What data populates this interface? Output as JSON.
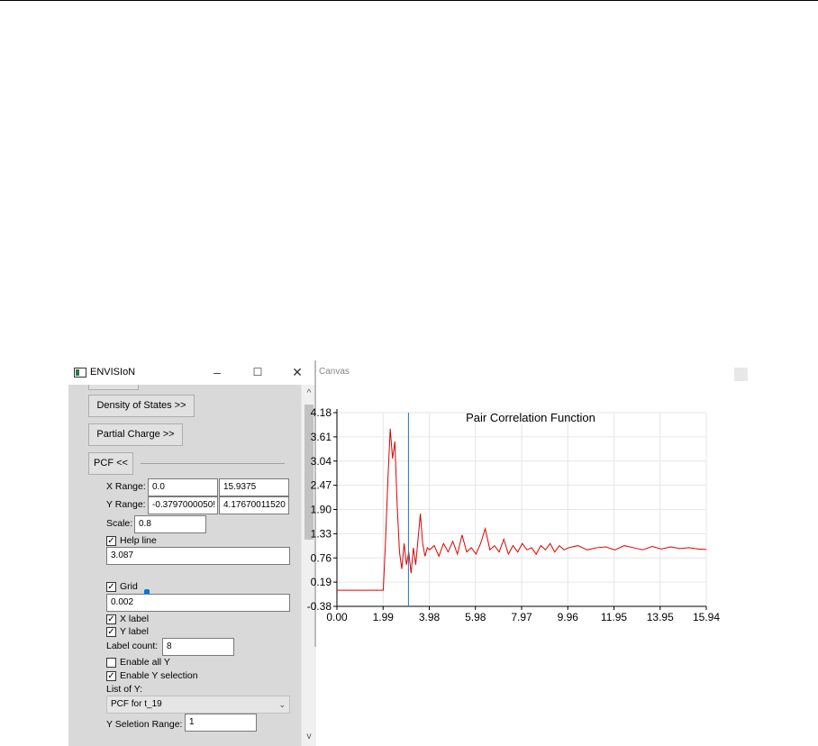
{
  "window": {
    "title": "ENVISIoN",
    "minimize": "–",
    "maximize": "☐",
    "close": "✕"
  },
  "panel": {
    "dos_button": "Density of States >>",
    "partial_charge_button": "Partial Charge >>",
    "pcf_button": "PCF <<",
    "x_range_label": "X Range:",
    "x_range_min": "0.0",
    "x_range_max": "15.9375",
    "y_range_label": "Y Range:",
    "y_range_min": "-0.3797000050!",
    "y_range_max": "4.17670011520",
    "scale_label": "Scale:",
    "scale_value": "0.8",
    "help_line_label": "Help line",
    "help_line_checked": true,
    "help_line_value": "3.087",
    "help_line_slider_fraction": 0.19,
    "grid_label": "Grid",
    "grid_checked": true,
    "grid_value": "0.002",
    "x_label_label": "X label",
    "x_label_checked": true,
    "y_label_label": "Y label",
    "y_label_checked": true,
    "label_count_label": "Label count:",
    "label_count_value": "8",
    "enable_all_y_label": "Enable all Y",
    "enable_all_y_checked": false,
    "enable_y_selection_label": "Enable Y selection",
    "enable_y_selection_checked": true,
    "list_of_y_label": "List of Y:",
    "list_of_y_selected": "PCF for t_19",
    "y_selection_range_label": "Y Seletion Range:",
    "y_selection_range_value": "1"
  },
  "canvas": {
    "label": "Canvas"
  },
  "chart_data": {
    "type": "line",
    "title": "Pair Correlation Function",
    "xlim": [
      0.0,
      15.94
    ],
    "ylim": [
      -0.38,
      4.18
    ],
    "x_ticks": [
      "0.00",
      "1.99",
      "3.98",
      "5.98",
      "7.97",
      "9.96",
      "11.95",
      "13.95",
      "15.94"
    ],
    "y_ticks": [
      "4.18",
      "3.61",
      "3.04",
      "2.47",
      "1.90",
      "1.33",
      "0.76",
      "0.19",
      "-0.38"
    ],
    "help_line_x": 3.087,
    "grid": true,
    "colors": {
      "series": "#e00000",
      "help_line": "#1f77b4",
      "grid": "#e6e6e6"
    },
    "series": [
      {
        "color": "#e00000",
        "x": [
          0.0,
          1.0,
          2.0,
          2.1,
          2.2,
          2.3,
          2.4,
          2.5,
          2.6,
          2.7,
          2.8,
          2.9,
          3.0,
          3.1,
          3.2,
          3.3,
          3.4,
          3.5,
          3.6,
          3.7,
          3.8,
          3.9,
          4.0,
          4.2,
          4.4,
          4.6,
          4.8,
          5.0,
          5.2,
          5.4,
          5.6,
          5.8,
          6.0,
          6.2,
          6.4,
          6.6,
          6.8,
          7.0,
          7.2,
          7.4,
          7.6,
          7.8,
          8.0,
          8.2,
          8.4,
          8.6,
          8.8,
          9.0,
          9.2,
          9.4,
          9.6,
          9.8,
          10.0,
          10.4,
          10.8,
          11.2,
          11.6,
          12.0,
          12.4,
          12.8,
          13.2,
          13.6,
          14.0,
          14.4,
          14.8,
          15.2,
          15.6,
          15.94
        ],
        "y": [
          0.0,
          0.0,
          0.0,
          1.2,
          2.6,
          3.8,
          3.1,
          3.5,
          2.0,
          0.9,
          0.5,
          1.1,
          0.6,
          0.9,
          0.4,
          1.0,
          0.6,
          1.2,
          1.8,
          1.1,
          0.8,
          1.0,
          0.95,
          1.05,
          0.8,
          1.1,
          0.9,
          1.15,
          0.85,
          1.3,
          0.9,
          1.0,
          0.85,
          1.1,
          1.45,
          0.95,
          1.05,
          0.9,
          1.2,
          0.85,
          1.05,
          0.9,
          1.1,
          0.95,
          1.0,
          0.85,
          1.05,
          0.95,
          1.1,
          0.9,
          1.05,
          0.95,
          1.0,
          1.05,
          0.95,
          1.0,
          1.02,
          0.95,
          1.05,
          1.0,
          0.95,
          1.03,
          0.97,
          1.02,
          0.98,
          1.0,
          0.97,
          0.96
        ]
      }
    ]
  }
}
